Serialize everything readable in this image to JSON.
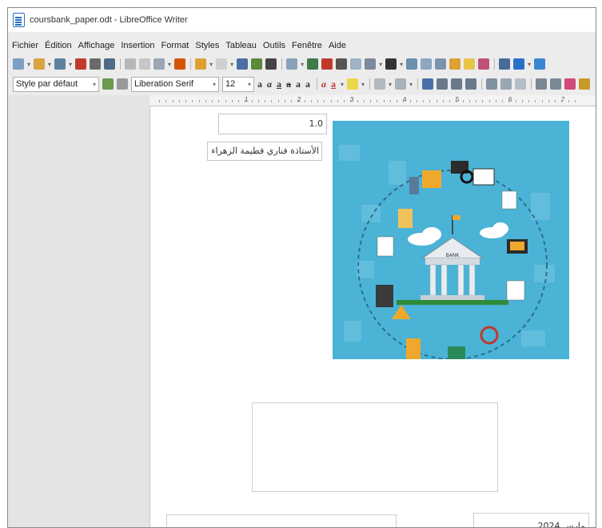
{
  "window": {
    "title": "coursbank_paper.odt - LibreOffice Writer"
  },
  "menubar": {
    "items": [
      "Fichier",
      "Édition",
      "Affichage",
      "Insertion",
      "Format",
      "Styles",
      "Tableau",
      "Outils",
      "Fenêtre",
      "Aide"
    ]
  },
  "toolbar": {
    "paragraph_style": "Style par défaut",
    "font_name": "Liberation Serif",
    "font_size": "12",
    "icons": {
      "standard": [
        "new-document",
        "open",
        "save",
        "export-pdf",
        "print",
        "print-preview",
        "cut",
        "copy",
        "paste",
        "clone-formatting",
        "undo",
        "redo",
        "find-replace",
        "spelling",
        "formatting-marks",
        "insert-table",
        "insert-image",
        "insert-chart",
        "insert-text-box",
        "insert-page-break",
        "insert-field",
        "insert-special-character",
        "insert-hyperlink",
        "insert-footnote",
        "insert-endnote",
        "insert-bookmark",
        "insert-cross-reference",
        "insert-comment",
        "track-changes",
        "insert-line",
        "basic-shapes",
        "toggle-draw-functions"
      ],
      "formatting": [
        "update-style",
        "new-style",
        "bold",
        "italic",
        "underline",
        "strikethrough",
        "superscript",
        "subscript",
        "clear-formatting",
        "font-color",
        "highlighting-color",
        "toggle-unordered-list",
        "toggle-ordered-list",
        "align-left",
        "align-center",
        "align-right",
        "justified",
        "line-spacing",
        "increase-indent",
        "decrease-indent",
        "left-to-right",
        "right-to-left"
      ]
    }
  },
  "ruler": {
    "labels": [
      "1",
      "2",
      "3",
      "4",
      "5",
      "6",
      "7"
    ]
  },
  "document": {
    "version_box": "1.0",
    "author_box": "الأستاذة فناري فطيمة الزهراء",
    "date_box": "مارس 2024",
    "image": {
      "label": "BANK",
      "colors": {
        "background": "#4ab3d6",
        "building": "#e8ecf0",
        "ground": "#2f8a3a",
        "accent": "#f0a82c"
      }
    }
  },
  "colors": {
    "chrome": "#ececec",
    "side_pane": "#e4e4e4",
    "page": "#ffffff",
    "doc_icon": "#2a6fbd"
  }
}
